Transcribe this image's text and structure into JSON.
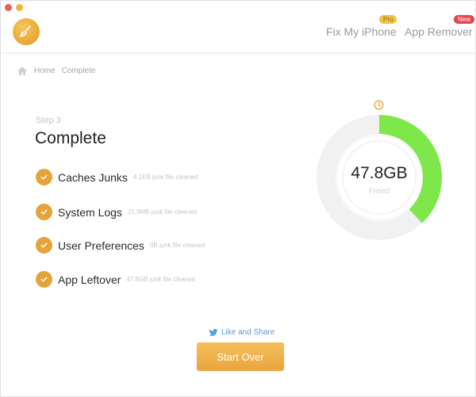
{
  "header": {
    "logo_icon": "broom-icon",
    "nav": [
      {
        "label": "Fix My iPhone",
        "badge": "Pro"
      },
      {
        "label": "App Remover",
        "badge": "New"
      }
    ]
  },
  "breadcrumb": {
    "icon": "home-icon",
    "items": [
      "Home",
      "Complete"
    ]
  },
  "main": {
    "step_label": "Step 3",
    "title": "Complete",
    "results": [
      {
        "name": "Caches Junks",
        "note": "4.1KB junk file cleaned"
      },
      {
        "name": "System Logs",
        "note": "21.9MB junk file cleaned"
      },
      {
        "name": "User Preferences",
        "note": "0B junk file cleaned"
      },
      {
        "name": "App Leftover",
        "note": "47.8GB junk file cleaned"
      }
    ]
  },
  "ring": {
    "value": "47.8GB",
    "label": "Freed",
    "fill_fraction": 0.38,
    "fill_color": "#7ee84a",
    "track_color": "#f1f1f1"
  },
  "footer": {
    "share_label": "Like and Share",
    "share_icon": "twitter-icon",
    "start_over_label": "Start Over"
  },
  "colors": {
    "accent": "#e9a53a",
    "success": "#7ee84a"
  }
}
